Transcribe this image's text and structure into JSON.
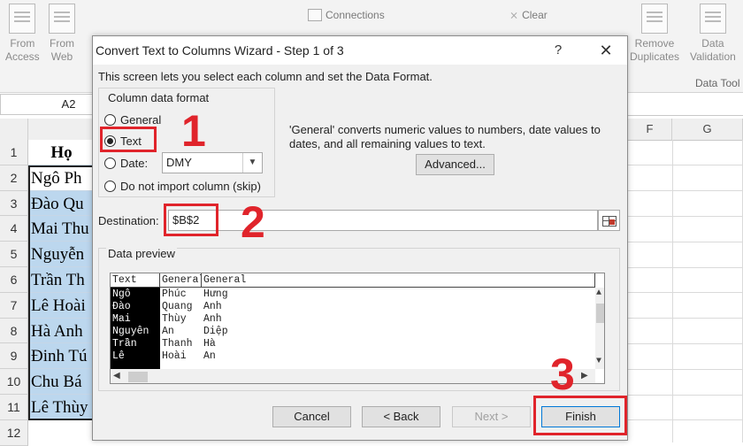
{
  "ribbon": {
    "from_access": [
      "From",
      "Access"
    ],
    "from_web": [
      "From",
      "Web"
    ],
    "connections": "Connections",
    "clear": "Clear",
    "remove_duplicates": [
      "Remove",
      "Duplicates"
    ],
    "data_validation": [
      "Data",
      "Validation"
    ],
    "group_data_tools": "Data Tool"
  },
  "name_box": "A2",
  "columns": [
    "F",
    "G"
  ],
  "rows": [
    "1",
    "2",
    "3",
    "4",
    "5",
    "6",
    "7",
    "8",
    "9",
    "10",
    "11",
    "12"
  ],
  "column_a": [
    "Họ",
    "Ngô Ph",
    "Đào Qu",
    "Mai Thu",
    "Nguyễn",
    "Trần Th",
    "Lê Hoài",
    "Hà Anh",
    "Đinh Tú",
    "Chu Bá",
    "Lê Thùy"
  ],
  "dialog": {
    "title": "Convert Text to Columns Wizard - Step 1 of 3",
    "help": "?",
    "close": "✕",
    "instruction": "This screen lets you select each column and set the Data Format.",
    "format_group": "Column data format",
    "radios": {
      "general": "General",
      "text": "Text",
      "date": "Date:",
      "skip": "Do not import column (skip)"
    },
    "date_value": "DMY",
    "description": "'General' converts numeric values to numbers, date values to dates, and all remaining values to text.",
    "advanced": "Advanced...",
    "destination_label": "Destination:",
    "destination_value": "$B$2",
    "preview_label": "Data preview",
    "preview_headers": [
      "Text",
      "General",
      "General"
    ],
    "preview_rows": [
      [
        "Ngô",
        "Phúc",
        "Hưng"
      ],
      [
        "Đào",
        "Quang",
        "Anh"
      ],
      [
        "Mai",
        "Thùy",
        "Anh"
      ],
      [
        "Nguyễn",
        "An",
        "Diệp"
      ],
      [
        "Trần",
        "Thanh",
        "Hà"
      ],
      [
        "Lê",
        "Hoài",
        "An"
      ]
    ],
    "buttons": {
      "cancel": "Cancel",
      "back": "< Back",
      "next": "Next >",
      "finish": "Finish"
    }
  },
  "annotations": [
    "1",
    "2",
    "3"
  ],
  "colors": {
    "annotation_red": "#e0242b",
    "selection_blue": "#bcd7ee"
  }
}
